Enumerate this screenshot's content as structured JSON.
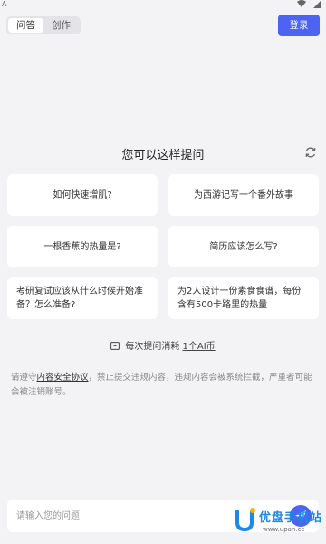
{
  "status_bar": {
    "left_icon": "A"
  },
  "top_bar": {
    "tabs": [
      {
        "label": "问答"
      },
      {
        "label": "创作"
      }
    ],
    "login_label": "登录"
  },
  "suggestions": {
    "title": "您可以这样提问",
    "items": [
      {
        "text": "如何快速增肌?"
      },
      {
        "text": "为西游记写一个番外故事"
      },
      {
        "text": "一根香蕉的热量是?"
      },
      {
        "text": "简历应该怎么写?"
      },
      {
        "text": "考研复试应该从什么时候开始准备？怎么准备?"
      },
      {
        "text": "为2人设计一份素食食谱，每份含有500卡路里的热量"
      }
    ]
  },
  "cost": {
    "prefix": "每次提问消耗",
    "amount": "1个AI币"
  },
  "notice": {
    "before": "请遵守",
    "link": "内容安全协议",
    "after": "，禁止提交违规内容，违规内容会被系统拦截，严重者可能会被注销账号。"
  },
  "input": {
    "placeholder": "请输入您的问题"
  },
  "watermark": {
    "title": "优盘手机站",
    "url": "www.upan.cc"
  },
  "colors": {
    "accent": "#4d63f1",
    "background": "#f3f3f5"
  }
}
